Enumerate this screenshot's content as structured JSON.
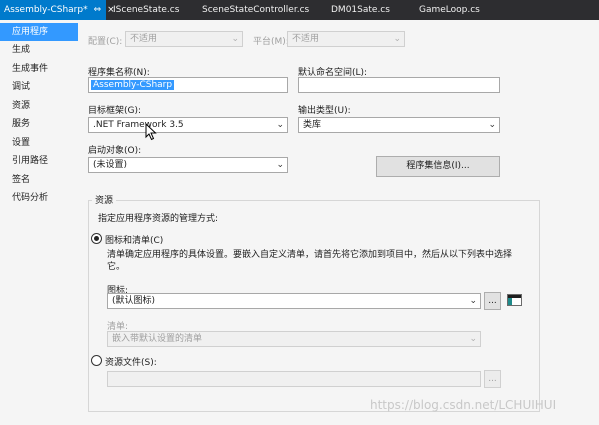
{
  "tabs": [
    {
      "label": "Assembly-CSharp*",
      "pin": "⇔",
      "close": "×"
    },
    {
      "label": "ISceneState.cs"
    },
    {
      "label": "SceneStateController.cs"
    },
    {
      "label": "DM01Sate.cs"
    },
    {
      "label": "GameLoop.cs"
    }
  ],
  "nav": {
    "items": [
      "应用程序",
      "生成",
      "生成事件",
      "调试",
      "资源",
      "服务",
      "设置",
      "引用路径",
      "签名",
      "代码分析"
    ]
  },
  "config": {
    "config_label": "配置(C):",
    "config_value": "不适用",
    "platform_label": "平台(M):",
    "platform_value": "不适用"
  },
  "app": {
    "assembly_name_label": "程序集名称(N):",
    "assembly_name_value": "Assembly-CSharp",
    "default_namespace_label": "默认命名空间(L):",
    "default_namespace_value": "",
    "target_framework_label": "目标框架(G):",
    "target_framework_value": ".NET Framework 3.5",
    "output_type_label": "输出类型(U):",
    "output_type_value": "类库",
    "startup_object_label": "启动对象(O):",
    "startup_object_value": "(未设置)",
    "assembly_info_button": "程序集信息(I)..."
  },
  "resources": {
    "group_title": "资源",
    "description": "指定应用程序资源的管理方式:",
    "icon_manifest_label": "图标和清单(C)",
    "icon_manifest_desc": "清单确定应用程序的具体设置。要嵌入自定义清单，请首先将它添加到项目中，然后从以下列表中选择它。",
    "icon_label": "图标:",
    "icon_value": "(默认图标)",
    "browse_button": "...",
    "manifest_label": "清单:",
    "manifest_value": "嵌入带默认设置的清单",
    "resource_file_label": "资源文件(S):",
    "resource_file_value": "",
    "resource_browse_button": "..."
  },
  "watermark": "https://blog.csdn.net/LCHUIHUI",
  "colors": {
    "accent": "#007acc",
    "tabbar": "#2d2d30",
    "nav_selected": "#3399ff"
  }
}
